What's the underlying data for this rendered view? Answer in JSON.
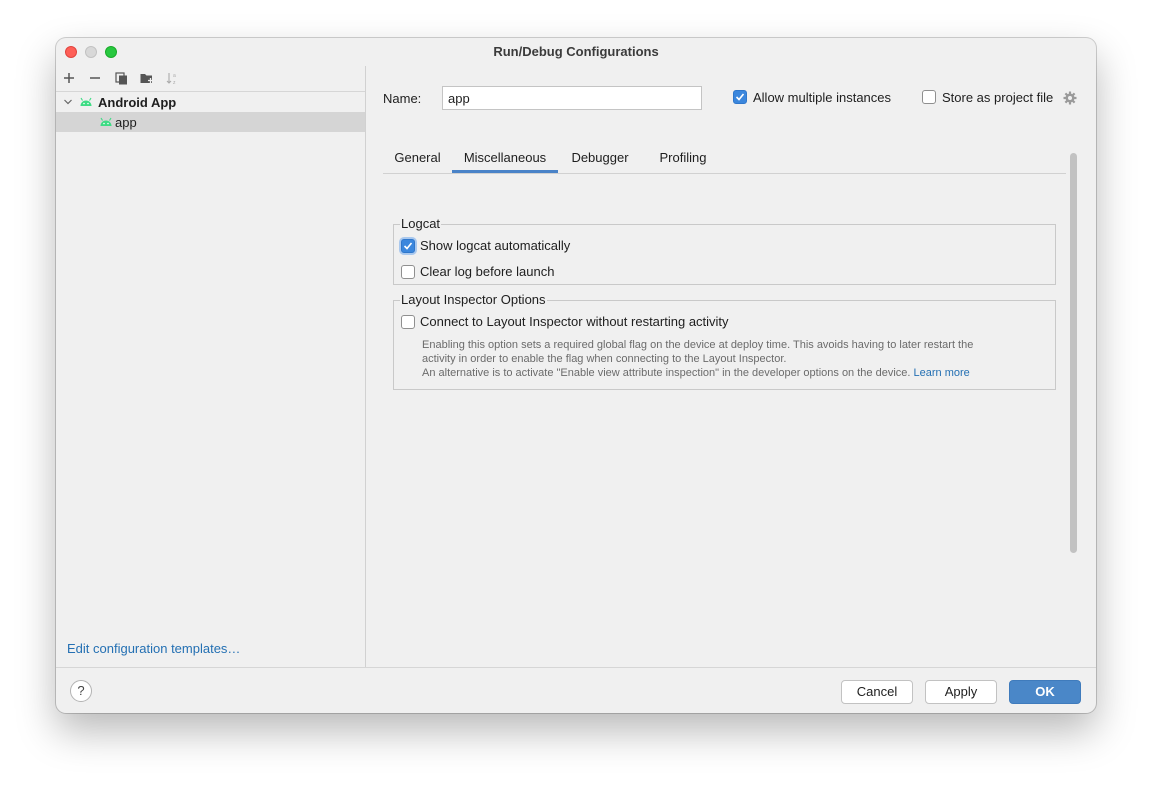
{
  "window": {
    "title": "Run/Debug Configurations"
  },
  "sidebar": {
    "toolbar": {
      "icons": [
        "plus-icon",
        "minus-icon",
        "copy-icon",
        "new-folder-icon",
        "sort-icon"
      ]
    },
    "tree": {
      "group_label": "Android App",
      "item_label": "app"
    },
    "edit_templates_link": "Edit configuration templates…"
  },
  "form": {
    "name_label": "Name:",
    "name_value": "app",
    "allow_multiple_label": "Allow multiple instances",
    "allow_multiple_checked": true,
    "store_project_label": "Store as project file",
    "store_project_checked": false
  },
  "tabs": [
    {
      "label": "General",
      "active": false
    },
    {
      "label": "Miscellaneous",
      "active": true
    },
    {
      "label": "Debugger",
      "active": false
    },
    {
      "label": "Profiling",
      "active": false
    }
  ],
  "logcat": {
    "title": "Logcat",
    "show_logcat_label": "Show logcat automatically",
    "show_logcat_checked": true,
    "clear_log_label": "Clear log before launch",
    "clear_log_checked": false
  },
  "layout_inspector": {
    "title": "Layout Inspector Options",
    "connect_label": "Connect to Layout Inspector without restarting activity",
    "connect_checked": false,
    "help_line1": "Enabling this option sets a required global flag on the device at deploy time. This avoids having to later restart the",
    "help_line2": "activity in order to enable the flag when connecting to the Layout Inspector.",
    "help_line3": "An alternative is to activate \"Enable view attribute inspection\" in the developer options on the device.",
    "learn_more": "Learn more"
  },
  "footer": {
    "help_label": "?",
    "cancel_label": "Cancel",
    "apply_label": "Apply",
    "ok_label": "OK"
  },
  "colors": {
    "accent": "#4a87c8",
    "link": "#2470b3",
    "android_green": "#3ddc84",
    "selection": "#d5d5d5"
  }
}
